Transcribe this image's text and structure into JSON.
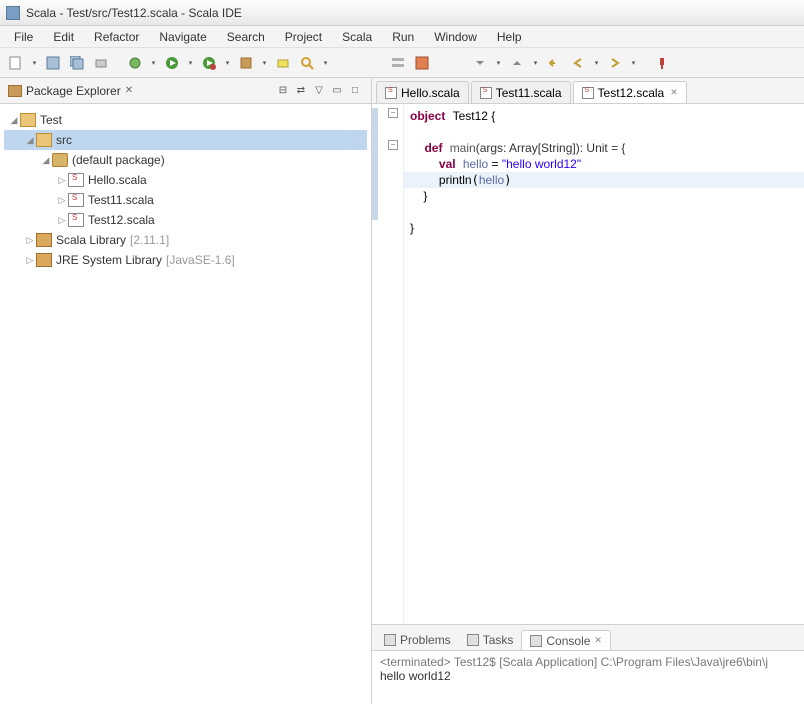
{
  "window": {
    "title": "Scala - Test/src/Test12.scala - Scala IDE"
  },
  "menu": {
    "items": [
      "File",
      "Edit",
      "Refactor",
      "Navigate",
      "Search",
      "Project",
      "Scala",
      "Run",
      "Window",
      "Help"
    ]
  },
  "explorer": {
    "title": "Package Explorer",
    "project": "Test",
    "src_folder": "src",
    "default_pkg": "(default package)",
    "files": [
      "Hello.scala",
      "Test11.scala",
      "Test12.scala"
    ],
    "scala_lib": "Scala Library",
    "scala_lib_ver": "[2.11.1]",
    "jre_lib": "JRE System Library",
    "jre_ver": "[JavaSE-1.6]"
  },
  "editor": {
    "tabs": [
      "Hello.scala",
      "Test11.scala",
      "Test12.scala"
    ],
    "active_tab": 2,
    "code": {
      "l1_kw": "object",
      "l1_name": "Test12",
      "l1_brace": " {",
      "l3_kw1": "def",
      "l3_name": "main",
      "l3_sig1": "(args: Array[String]): Unit = {",
      "l4_kw": "val",
      "l4_id": "hello",
      "l4_eq": " = ",
      "l4_str": "\"hello world12\"",
      "l5_fn": "println",
      "l5_arg": "hello",
      "l6": "    }",
      "l8": "}"
    }
  },
  "bottom": {
    "tabs": [
      "Problems",
      "Tasks",
      "Console"
    ],
    "active_tab": 2,
    "console_header": "<terminated> Test12$ [Scala Application] C:\\Program Files\\Java\\jre6\\bin\\j",
    "console_output": "hello world12"
  }
}
